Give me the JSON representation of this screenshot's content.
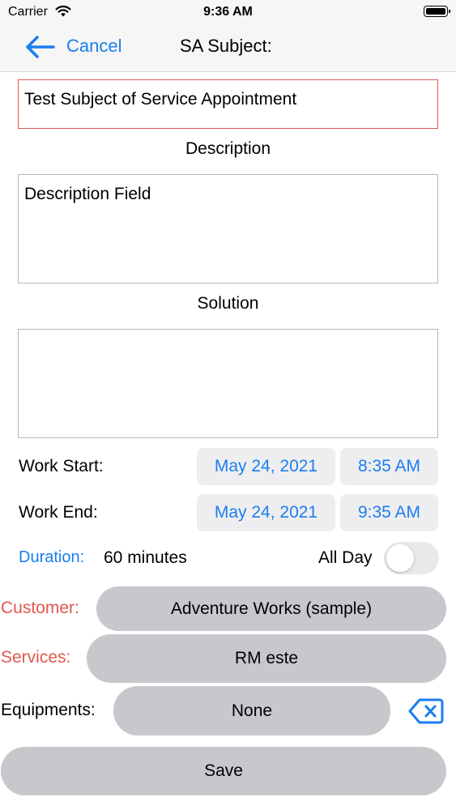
{
  "status": {
    "carrier": "Carrier",
    "time": "9:36 AM"
  },
  "nav": {
    "cancel": "Cancel",
    "title": "SA Subject:"
  },
  "subject": {
    "value": "Test Subject of Service Appointment"
  },
  "description": {
    "label": "Description",
    "value": "Description Field"
  },
  "solution": {
    "label": "Solution",
    "value": ""
  },
  "work_start": {
    "label": "Work Start:",
    "date": "May 24, 2021",
    "time": "8:35 AM"
  },
  "work_end": {
    "label": "Work End:",
    "date": "May 24, 2021",
    "time": "9:35 AM"
  },
  "duration": {
    "label": "Duration:",
    "value": "60 minutes"
  },
  "all_day": {
    "label": "All Day",
    "on": false
  },
  "customer": {
    "label": "Customer:",
    "value": "Adventure Works (sample)"
  },
  "services": {
    "label": "Services:",
    "value": "RM este"
  },
  "equipments": {
    "label": "Equipments:",
    "value": "None"
  },
  "save": {
    "label": "Save"
  },
  "colors": {
    "accent": "#1a7ef0",
    "required": "#e0584f",
    "button_gray": "#c7c7cc"
  }
}
